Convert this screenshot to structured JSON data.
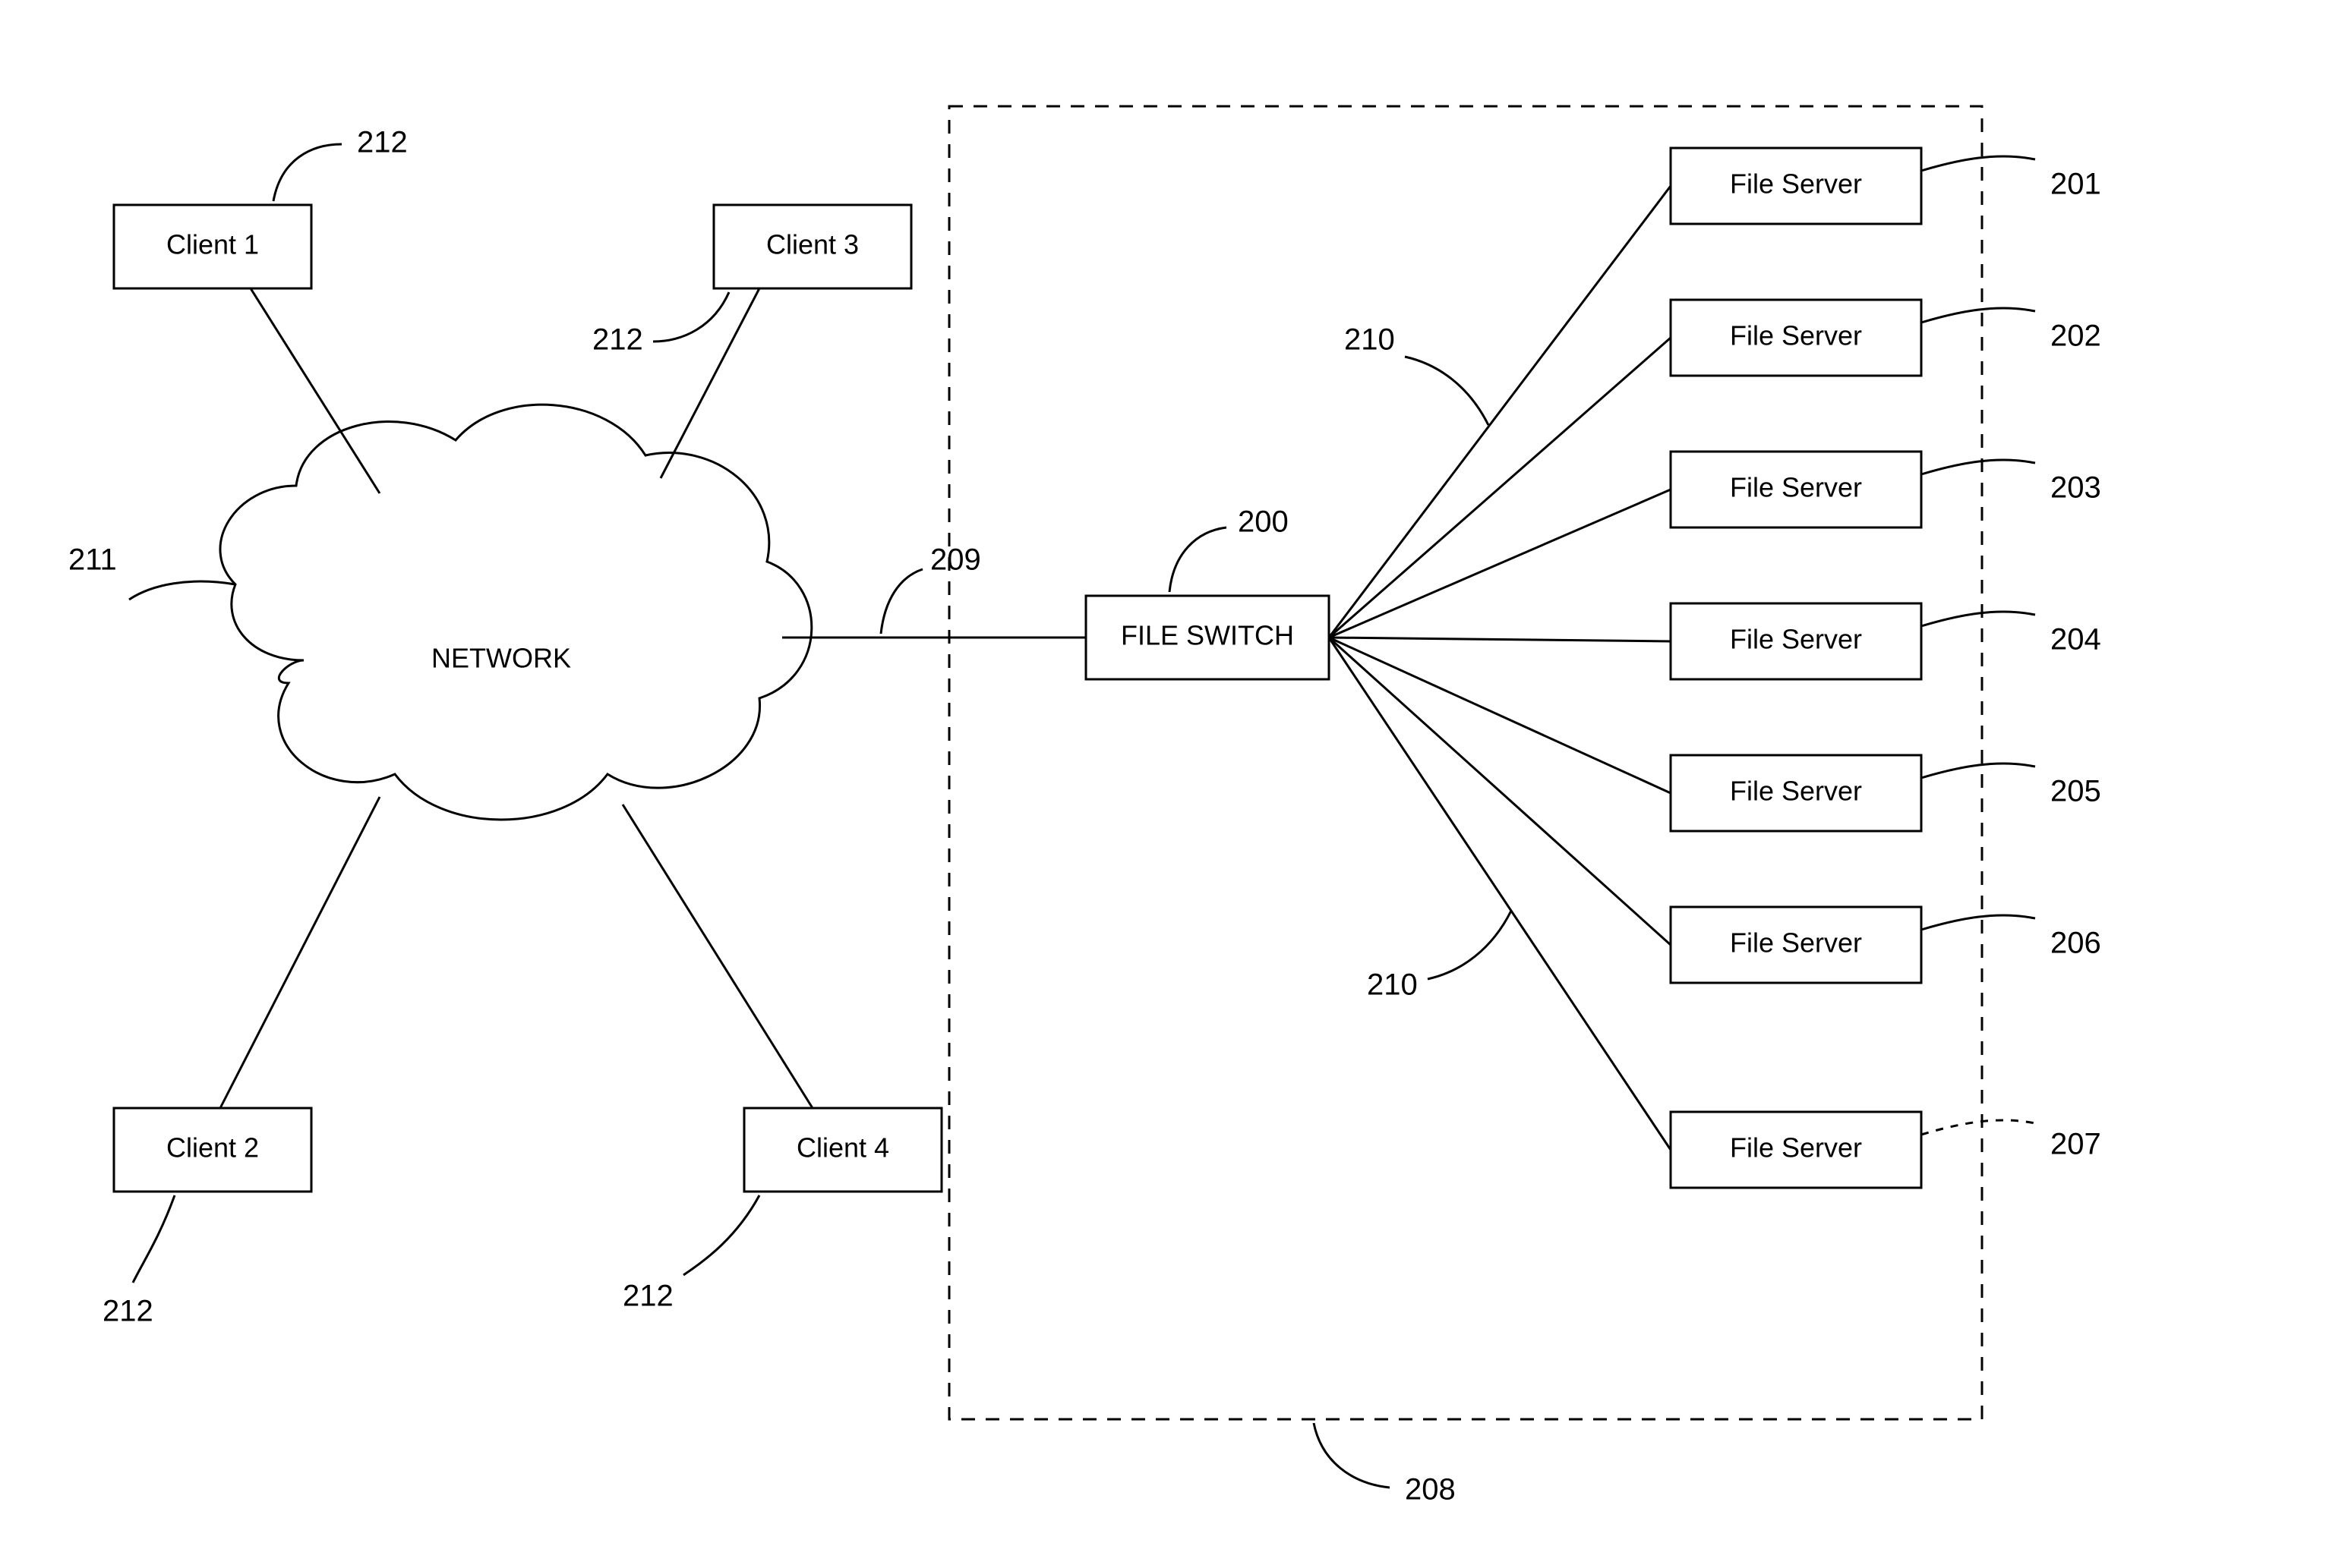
{
  "clients": [
    {
      "label": "Client 1",
      "ref": "212"
    },
    {
      "label": "Client 2",
      "ref": "212"
    },
    {
      "label": "Client 3",
      "ref": "212"
    },
    {
      "label": "Client 4",
      "ref": "212"
    }
  ],
  "network": {
    "label": "NETWORK",
    "ref": "211",
    "link_ref": "209"
  },
  "file_switch": {
    "label": "FILE SWITCH",
    "ref": "200"
  },
  "server_group_ref_top": "210",
  "server_group_ref_bottom": "210",
  "boundary_ref": "208",
  "servers": [
    {
      "label": "File Server",
      "ref": "201"
    },
    {
      "label": "File Server",
      "ref": "202"
    },
    {
      "label": "File Server",
      "ref": "203"
    },
    {
      "label": "File Server",
      "ref": "204"
    },
    {
      "label": "File Server",
      "ref": "205"
    },
    {
      "label": "File Server",
      "ref": "206"
    },
    {
      "label": "File Server",
      "ref": "207"
    }
  ]
}
